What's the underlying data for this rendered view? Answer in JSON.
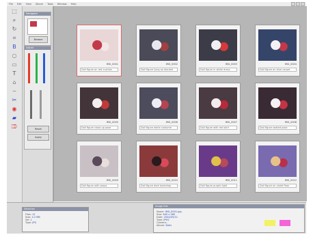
{
  "menu": [
    "File",
    "Edit",
    "View",
    "Album",
    "Tools",
    "Window",
    "Help"
  ],
  "tools": [
    {
      "name": "select-icon",
      "glyph": "⬚",
      "color": "#445"
    },
    {
      "name": "zoom-icon",
      "glyph": "⌕",
      "color": "#445"
    },
    {
      "name": "rotate-icon",
      "glyph": "↻",
      "color": "#667"
    },
    {
      "name": "crop-icon",
      "glyph": "⌗",
      "color": "#667"
    },
    {
      "name": "bold-icon",
      "glyph": "B",
      "color": "#3a55c8"
    },
    {
      "name": "circle-icon",
      "glyph": "○",
      "color": "#777"
    },
    {
      "name": "rect-icon",
      "glyph": "▭",
      "color": "#777"
    },
    {
      "name": "text-icon",
      "glyph": "T",
      "color": "#555"
    },
    {
      "name": "home-icon",
      "glyph": "⌂",
      "color": "#777"
    },
    {
      "name": "line-icon",
      "glyph": "─",
      "color": "#777"
    },
    {
      "name": "cut-icon",
      "glyph": "✂",
      "color": "#3a55c8"
    },
    {
      "name": "record-icon",
      "glyph": "◉",
      "color": "#d33"
    },
    {
      "name": "folder-icon",
      "glyph": "▰",
      "color": "#2a3fd0"
    },
    {
      "name": "red-tool-icon",
      "glyph": "⎄",
      "color": "#d22"
    }
  ],
  "navigator": {
    "title": "Navigator",
    "button": "Browse"
  },
  "adjust": {
    "title": "Adjust",
    "reset": "Reset",
    "apply": "Apply",
    "colors": [
      "#e23a2a",
      "#2ab34a",
      "#2a5ad6"
    ]
  },
  "thumbs": [
    {
      "name": "IMG_0001",
      "caption": "Doll figure on red cushion",
      "bg": "#e9d6d6",
      "a": "#c23a4a",
      "b": "#f4e6e6",
      "sel": true
    },
    {
      "name": "IMG_0002",
      "caption": "Doll figure lying on blanket",
      "bg": "#4a4a58",
      "a": "#e8e8f0",
      "b": "#a04040",
      "sel": false
    },
    {
      "name": "IMG_0003",
      "caption": "Doll figure in white dress",
      "bg": "#3c3c48",
      "a": "#f0f0f4",
      "b": "#d43a3a",
      "sel": false
    },
    {
      "name": "IMG_0004",
      "caption": "Doll figure on blue carpet",
      "bg": "#35456a",
      "a": "#f2f2f6",
      "b": "#c23848",
      "sel": false
    },
    {
      "name": "IMG_0005",
      "caption": "Doll figure close-up pose",
      "bg": "#43343a",
      "a": "#f2eeee",
      "b": "#c03a3a",
      "sel": false
    },
    {
      "name": "IMG_0006",
      "caption": "Doll figure white costume",
      "bg": "#4c4c5c",
      "a": "#ececf4",
      "b": "#b64450",
      "sel": false
    },
    {
      "name": "IMG_0007",
      "caption": "Doll figure with red skirt",
      "bg": "#4a3a42",
      "a": "#f4ecec",
      "b": "#b82a3a",
      "sel": false
    },
    {
      "name": "IMG_0008",
      "caption": "Doll figure seated pose",
      "bg": "#3a2a34",
      "a": "#f6f0f0",
      "b": "#c43444",
      "sel": false
    },
    {
      "name": "IMG_0009",
      "caption": "Doll figure with props",
      "bg": "#c8c0c4",
      "a": "#5a4a5a",
      "b": "#e8dede",
      "sel": false
    },
    {
      "name": "IMG_0010",
      "caption": "Doll figure dark backdrop",
      "bg": "#8a3a3a",
      "a": "#2a1a1e",
      "b": "#d84a5a",
      "sel": false
    },
    {
      "name": "IMG_0011",
      "caption": "Doll figure purple light",
      "bg": "#6a3a8a",
      "a": "#e0c04a",
      "b": "#b84a5a",
      "sel": false
    },
    {
      "name": "IMG_0012",
      "caption": "Doll figure on violet floor",
      "bg": "#7a6ab0",
      "a": "#e6c28a",
      "b": "#b8304a",
      "sel": false
    }
  ],
  "status": {
    "title": "Selection",
    "rows": [
      [
        "Files:",
        "12"
      ],
      [
        "Size:",
        "4.2 MB"
      ],
      [
        "Sel:",
        "1"
      ],
      [
        "Type:",
        "JPG"
      ]
    ]
  },
  "info": {
    "title": "Image Info",
    "fields": [
      [
        "Name:",
        "IMG_0001.jpg"
      ],
      [
        "Size:",
        "640 x 480"
      ],
      [
        "Date:",
        "2004/05/12"
      ],
      [
        "Type:",
        "JPEG"
      ],
      [
        "Camera:",
        "-"
      ],
      [
        "Album:",
        "Dolls"
      ]
    ],
    "color1": "#f2f264",
    "color2": "#f264d8"
  }
}
